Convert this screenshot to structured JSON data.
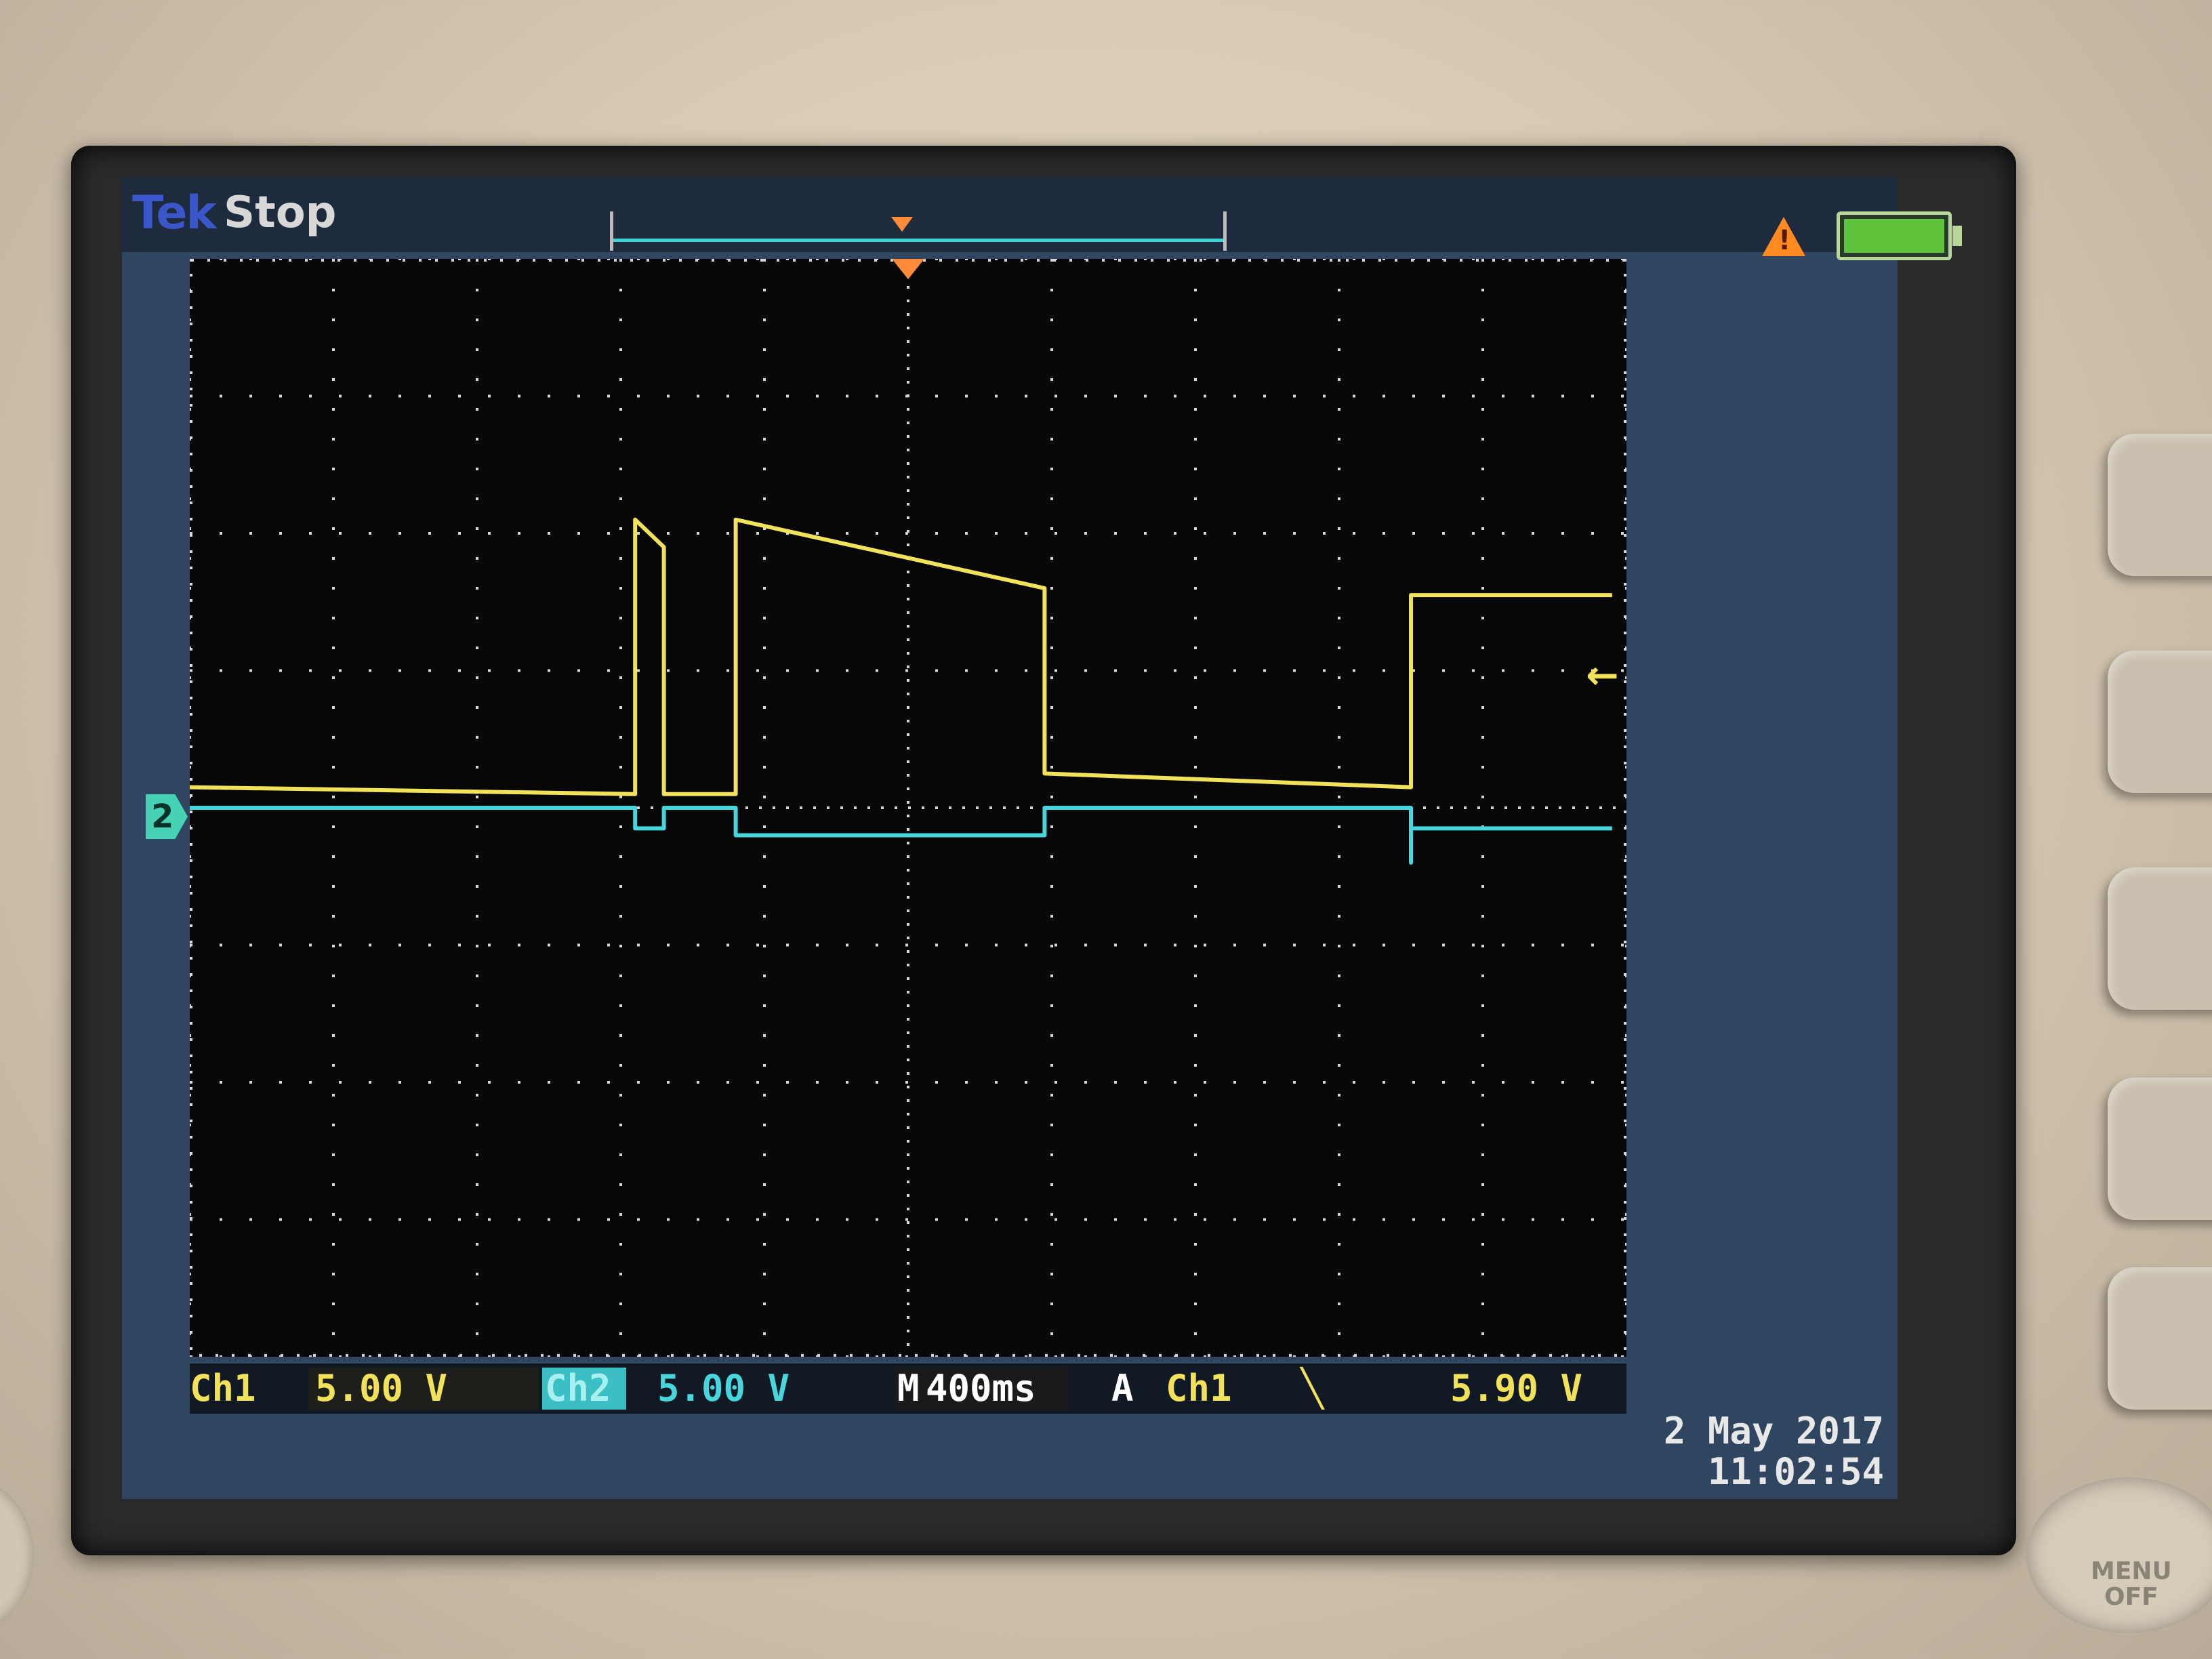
{
  "status": {
    "brand": "Tek",
    "run_state": "Stop"
  },
  "icons": {
    "warning": "warning-triangle-icon",
    "battery": "battery-full-icon",
    "trigger_position": "trigger-position-marker-icon",
    "channel2_ground": "channel-2-ground-marker-icon",
    "trigger_level": "trigger-level-arrow-icon"
  },
  "colors": {
    "ch1": "#f1e25a",
    "ch2": "#46d6dc",
    "grid": "#d8d8d8",
    "background": "#070707"
  },
  "channel_marker": {
    "label": "2"
  },
  "readout": {
    "ch1_label": "Ch1",
    "ch1_scale": "5.00 V",
    "ch2_label": "Ch2",
    "ch2_scale": "5.00 V",
    "timebase_label": "M",
    "timebase_value": "400ms",
    "trigger_label": "A",
    "trigger_source": "Ch1",
    "trigger_slope": "╲",
    "trigger_level": "5.90 V"
  },
  "timestamp": {
    "date": "2 May 2017",
    "time": "11:02:54"
  },
  "front_panel": {
    "menu_button": "MENU\nOFF"
  },
  "chart_data": {
    "type": "line",
    "x_divisions": 10,
    "y_divisions": 8,
    "series": [
      {
        "name": "Ch1",
        "points": [
          [
            0,
            4.15
          ],
          [
            3.1,
            4.1
          ],
          [
            3.1,
            6.1
          ],
          [
            3.3,
            5.9
          ],
          [
            3.3,
            4.1
          ],
          [
            3.8,
            4.1
          ],
          [
            3.8,
            6.1
          ],
          [
            5.95,
            5.6
          ],
          [
            5.95,
            4.25
          ],
          [
            8.5,
            4.15
          ],
          [
            8.5,
            5.55
          ],
          [
            9.9,
            5.55
          ]
        ]
      },
      {
        "name": "Ch2",
        "points": [
          [
            0,
            4.0
          ],
          [
            3.1,
            4.0
          ],
          [
            3.1,
            3.85
          ],
          [
            3.3,
            3.85
          ],
          [
            3.3,
            4.0
          ],
          [
            3.8,
            4.0
          ],
          [
            3.8,
            3.8
          ],
          [
            5.95,
            3.8
          ],
          [
            5.95,
            4.0
          ],
          [
            8.5,
            4.0
          ],
          [
            8.5,
            3.6
          ],
          [
            8.5,
            3.85
          ],
          [
            9.9,
            3.85
          ]
        ]
      }
    ],
    "xlim": [
      0,
      10
    ],
    "ylim": [
      0,
      8
    ],
    "grid": true
  }
}
